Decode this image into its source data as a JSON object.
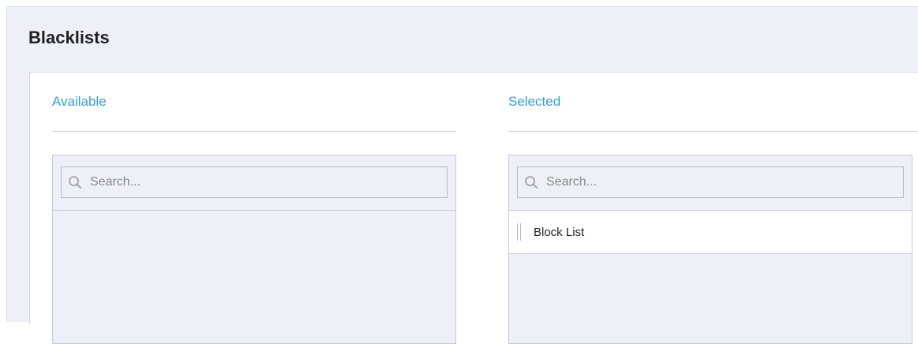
{
  "page": {
    "title": "Blacklists"
  },
  "available": {
    "heading": "Available",
    "search_placeholder": "Search...",
    "items": []
  },
  "selected": {
    "heading": "Selected",
    "search_placeholder": "Search...",
    "items": [
      {
        "label": "Block List"
      }
    ]
  },
  "colors": {
    "accent": "#2f9fe6",
    "panel_bg": "#efeff7",
    "title_text": "#222222"
  },
  "icons": {
    "search": "search-icon",
    "drag": "drag-handle-icon"
  }
}
